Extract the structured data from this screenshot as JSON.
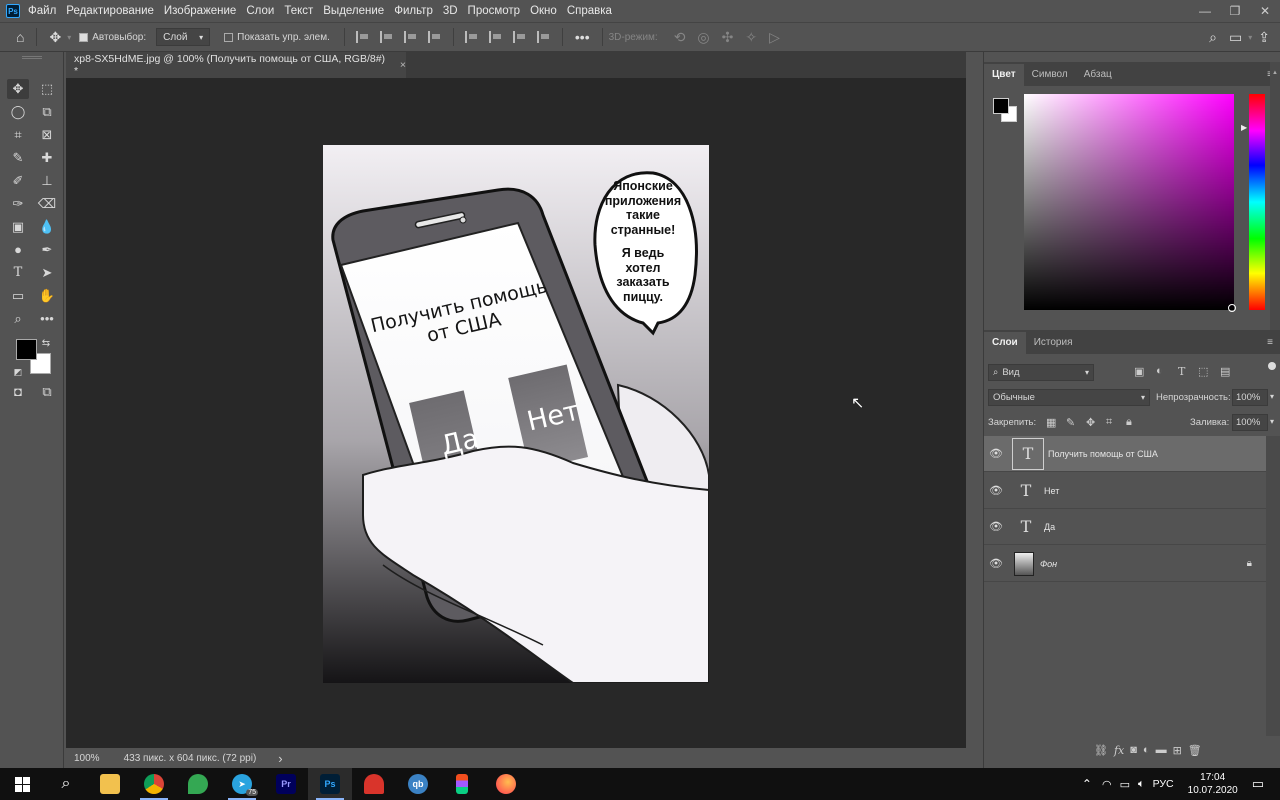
{
  "menubar": {
    "logo": "Ps",
    "items": [
      "Файл",
      "Редактирование",
      "Изображение",
      "Слои",
      "Текст",
      "Выделение",
      "Фильтр",
      "3D",
      "Просмотр",
      "Окно",
      "Справка"
    ]
  },
  "options": {
    "autoselect_label": "Автовыбор:",
    "autoselect_value": "Слой",
    "show_controls_label": "Показать упр. элем.",
    "mode_3d_label": "3D-режим:"
  },
  "document": {
    "tab_title": "xp8-SX5HdME.jpg @ 100% (Получить помощь от США, RGB/8#) *",
    "close_glyph": "×"
  },
  "artwork": {
    "screen_text": "Получить помощь от США",
    "button_yes": "Да",
    "button_no": "Нет",
    "bubble_line1": "Японские приложения такие странные!",
    "bubble_line2": "Я ведь хотел заказать пиццу."
  },
  "status": {
    "zoom": "100%",
    "doc_info": "433 пикс. x 604 пикс. (72 ppi)",
    "arrow": "›"
  },
  "color_panel": {
    "tabs": [
      "Цвет",
      "Символ",
      "Абзац"
    ],
    "active_tab": "Цвет",
    "hue_marker_level": 0.16
  },
  "layers_panel": {
    "tabs": [
      "Слои",
      "История"
    ],
    "active_tab": "Слои",
    "filter_label": "Вид",
    "blend_mode": "Обычные",
    "opacity_label": "Непрозрачность:",
    "opacity_value": "100%",
    "lock_label": "Закрепить:",
    "fill_label": "Заливка:",
    "fill_value": "100%",
    "layers": [
      {
        "name": "Получить помощь от США",
        "type": "text",
        "selected": true
      },
      {
        "name": "Нет",
        "type": "text",
        "selected": false
      },
      {
        "name": "Да",
        "type": "text",
        "selected": false
      },
      {
        "name": "Фон",
        "type": "image",
        "selected": false,
        "locked": true
      }
    ],
    "text_layer_glyph": "T"
  },
  "taskbar": {
    "language": "РУС",
    "time": "17:04",
    "date": "10.07.2020",
    "telegram_badge": "75"
  },
  "colors": {
    "foreground": "#000000",
    "background": "#ffffff",
    "selection": "#6b6b6b"
  }
}
